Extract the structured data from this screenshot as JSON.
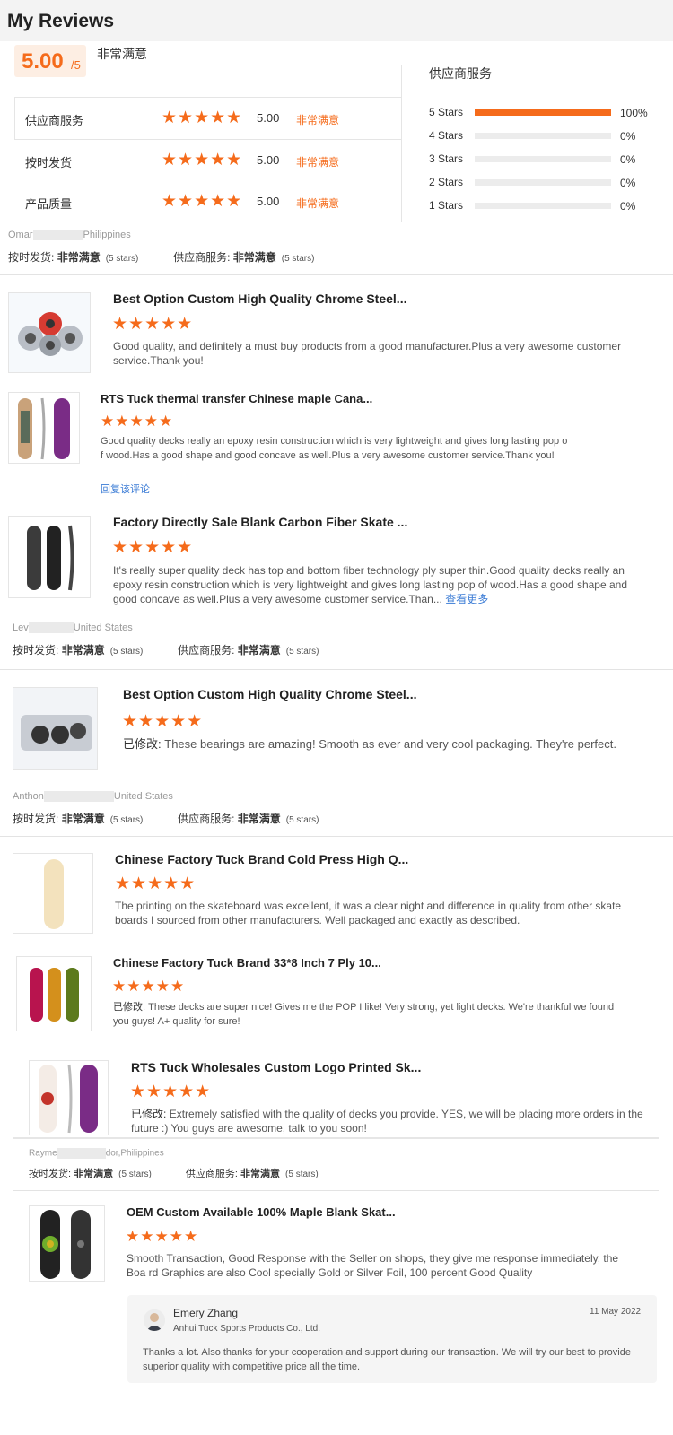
{
  "page": {
    "title": "My Reviews"
  },
  "summary": {
    "score": "5.00",
    "score_suffix": "/5",
    "overall": "非常满意",
    "rows": [
      {
        "label": "供应商服务",
        "value": "5.00",
        "satisfaction": "非常满意"
      },
      {
        "label": "按时发货",
        "value": "5.00",
        "satisfaction": "非常满意"
      },
      {
        "label": "产品质量",
        "value": "5.00",
        "satisfaction": "非常满意"
      }
    ]
  },
  "distribution": {
    "title": "供应商服务",
    "rows": [
      {
        "label": "5 Stars",
        "fraction": 1.0,
        "pct": "100%"
      },
      {
        "label": "4 Stars",
        "fraction": 0.0,
        "pct": "0%"
      },
      {
        "label": "3 Stars",
        "fraction": 0.0,
        "pct": "0%"
      },
      {
        "label": "2 Stars",
        "fraction": 0.0,
        "pct": "0%"
      },
      {
        "label": "1 Stars",
        "fraction": 0.0,
        "pct": "0%"
      }
    ]
  },
  "star_glyph": "★★★★★",
  "colors": {
    "accent": "#f56b1b",
    "link": "#3a7bd5"
  },
  "meta_labels": {
    "shipping": "按时发货:",
    "service": "供应商服务:",
    "satisfaction": "非常满意",
    "stars": "(5 stars)"
  },
  "reviewers": [
    {
      "name_start": "Omar",
      "name_end": "Philippines"
    },
    {
      "name_start": "Lev",
      "name_end": "United States"
    },
    {
      "name_start": "Anthon",
      "name_end": "United States"
    },
    {
      "name_start": "Rayme",
      "name_end": "dor,Philippines"
    }
  ],
  "reviews": [
    {
      "title": "Best Option Custom High Quality Chrome Steel...",
      "text": "Good quality, and definitely a must buy products from a good manufacturer.Plus a very awesome customer service.Thank you!"
    },
    {
      "title": "RTS Tuck thermal transfer Chinese maple Cana...",
      "text_line1": "Good quality decks really an epoxy resin construction which is very lightweight and gives long lasting pop o",
      "text_line2": "f wood.Has a good shape and good concave as well.Plus a very awesome customer service.Thank you!",
      "reply_link": "回复该评论"
    },
    {
      "title": "Factory Directly Sale Blank Carbon Fiber Skate ...",
      "text": "It's really super quality deck has top and bottom fiber technology ply super thin.Good quality decks really an epoxy resin construction which is very lightweight and gives long lasting pop of wood.Has a good shape and good concave as well.Plus a very awesome customer service.Than...",
      "more": "查看更多"
    },
    {
      "title": "Best Option Custom High Quality Chrome Steel...",
      "edited": "已修改:",
      "text": "These bearings are amazing! Smooth as ever and very cool packaging. They're perfect."
    },
    {
      "title": "Chinese Factory Tuck Brand Cold Press High Q...",
      "text": "The printing on the skateboard was excellent, it was a clear night and difference in quality from other skate boards I sourced from other manufacturers. Well packaged and exactly as described."
    },
    {
      "title": "Chinese Factory Tuck Brand 33*8 Inch 7 Ply 10...",
      "edited": "已修改:",
      "text": "These decks are super nice! Gives me the POP I like! Very strong, yet light decks. We're thankful we found you guys! A+ quality for sure!"
    },
    {
      "title": "RTS Tuck Wholesales Custom Logo Printed Sk...",
      "edited": "已修改:",
      "text": "Extremely satisfied with the quality of decks you provide. YES, we will be placing more orders in the future :) You guys are awesome, talk to you soon!"
    },
    {
      "title": "OEM Custom Available 100% Maple Blank Skat...",
      "text": "Smooth Transaction, Good Response with the Seller on shops, they give me response immediately, the Boa rd Graphics are also Cool specially Gold or Silver Foil, 100 percent Good Quality"
    }
  ],
  "reply": {
    "name": "Emery Zhang",
    "company": "Anhui Tuck Sports Products Co., Ltd.",
    "date": "11 May 2022",
    "text": "Thanks a lot. Also thanks for your cooperation and support during our transaction. We will try our best to provide superior quality with competitive price all the time."
  }
}
